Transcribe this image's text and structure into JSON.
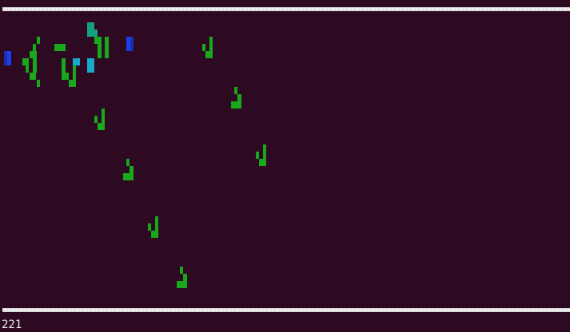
{
  "score": "221",
  "colors": {
    "background": "#2d0922",
    "wall": "#f0f0f0",
    "score_text": "#e6e6e6",
    "green": "#17a81b",
    "teal": "#16a17e",
    "cyan": "#1aa9c8",
    "blue": "#1a3fe6"
  },
  "sprites": [
    {
      "name": "green-note-sprite",
      "color": "green",
      "shape": "note",
      "count": 8
    },
    {
      "name": "green-bracket-sprite",
      "color": "green",
      "shape": "bracket",
      "count": 1
    },
    {
      "name": "teal-block-sprite",
      "color": "teal",
      "shape": "block",
      "count": 2
    },
    {
      "name": "cyan-block-sprite",
      "color": "cyan",
      "shape": "block",
      "count": 2
    },
    {
      "name": "blue-block-sprite",
      "color": "blue",
      "shape": "block",
      "count": 2
    }
  ]
}
